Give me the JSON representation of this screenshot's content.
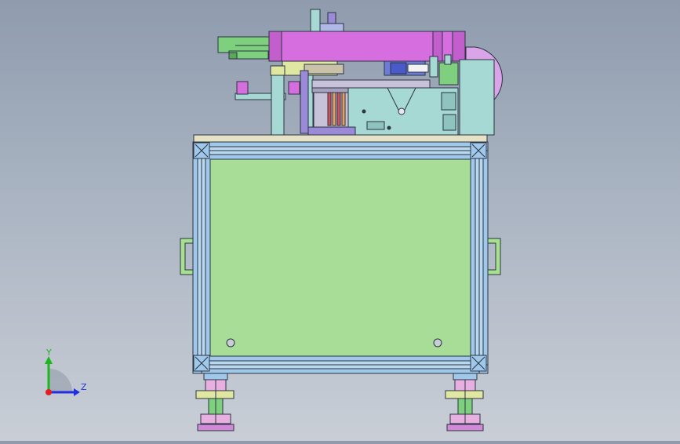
{
  "viewport": {
    "background_top": "#8f9cae",
    "background_bottom": "#c9ced6",
    "view": "front"
  },
  "triad": {
    "y_label": "Y",
    "z_label": "Z",
    "y_color": "#1fb51f",
    "z_color": "#2030e0",
    "origin_color": "#e02020"
  },
  "colors": {
    "frame_blue": "#9fc8ea",
    "panel_green": "#a8dd98",
    "tabletop": "#e6e2c6",
    "magenta": "#d66ee0",
    "cyan_plate": "#a6d8d4",
    "purple": "#9b8ad8",
    "handle_green": "#a7e08e",
    "green_part": "#7ed07e"
  }
}
